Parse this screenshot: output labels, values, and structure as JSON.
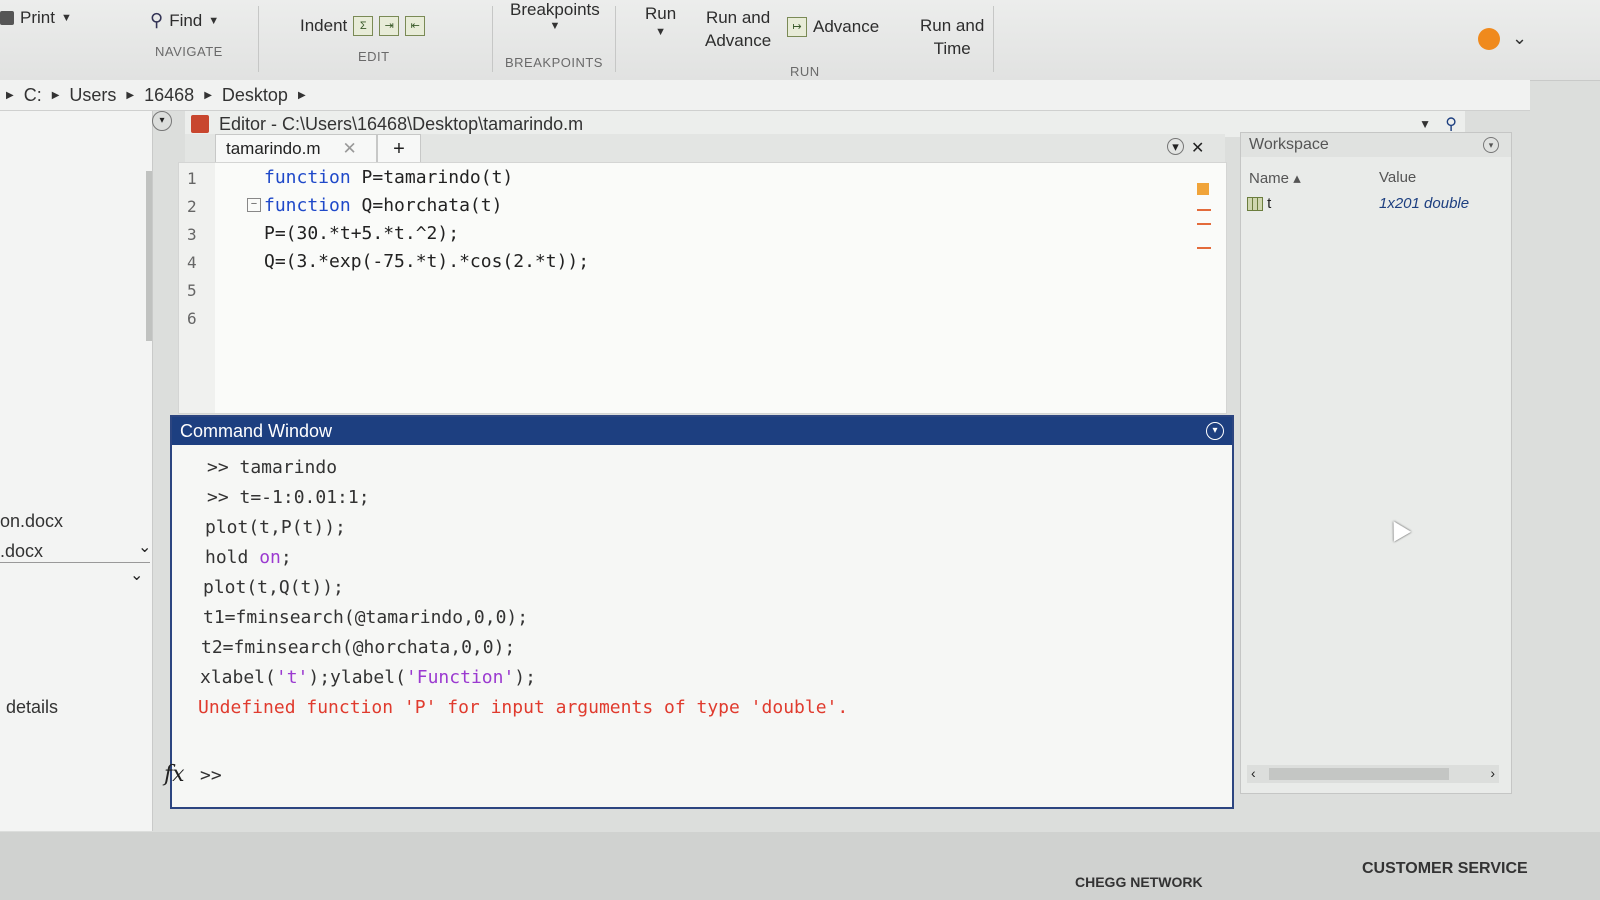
{
  "toolstrip": {
    "print_label": "Print",
    "find_label": "Find",
    "indent_label": "Indent",
    "breakpoints_label": "Breakpoints",
    "run_label": "Run",
    "run_advance_label": "Run and Advance",
    "run_advance_line1": "Run and",
    "run_advance_line2": "Advance",
    "advance_label": "Advance",
    "run_time_line1": "Run and",
    "run_time_line2": "Time",
    "groups": {
      "navigate": "NAVIGATE",
      "edit": "EDIT",
      "breakpoints": "BREAKPOINTS",
      "run": "RUN"
    }
  },
  "address": {
    "crumbs": [
      "C:",
      "Users",
      "16468",
      "Desktop"
    ]
  },
  "left_panel": {
    "files": [
      "on.docx",
      ".docx"
    ],
    "details_label": "details"
  },
  "editor": {
    "title": "Editor - C:\\Users\\16468\\Desktop\\tamarindo.m",
    "tab_name": "tamarindo.m",
    "add_tab": "+",
    "line_numbers": [
      "1",
      "2",
      "3",
      "4",
      "5",
      "6"
    ],
    "lines": [
      {
        "kw": "function",
        "rest": " P=tamarindo(t)"
      },
      {
        "kw": "function",
        "rest": " Q=horchata(t)"
      },
      {
        "kw": "",
        "rest": "P=(30.*t+5.*t.^2);"
      },
      {
        "kw": "",
        "rest": "Q=(3.*exp(-75.*t).*cos(2.*t));"
      }
    ]
  },
  "command_window": {
    "title": "Command Window",
    "lines": [
      ">> tamarindo",
      ">> t=-1:0.01:1;",
      "plot(t,P(t));",
      "hold on;",
      "plot(t,Q(t));",
      "t1=fminsearch(@tamarindo,0,0);",
      "t2=fminsearch(@horchata,0,0);",
      "xlabel('t');ylabel('Function');"
    ],
    "hold_prefix": "hold ",
    "hold_kw": "on",
    "hold_suffix": ";",
    "xlabel_prefix": "xlabel(",
    "xlabel_arg": "'t'",
    "ylabel_mid": ");ylabel(",
    "ylabel_arg": "'Function'",
    "ylabel_suffix": ");",
    "error": "Undefined function 'P' for input arguments of type 'double'.",
    "fx": "fx",
    "prompt": ">>"
  },
  "workspace": {
    "title": "Workspace",
    "col_name": "Name",
    "col_value": "Value",
    "var_name": "t",
    "var_value": "1x201 double"
  },
  "footer": {
    "network": "CHEGG NETWORK",
    "customer_service": "CUSTOMER SERVICE"
  },
  "colors": {
    "cmd_header": "#1d3f80",
    "keyword": "#1f49c9",
    "error": "#e03b2e",
    "string": "#9b3ad0"
  }
}
